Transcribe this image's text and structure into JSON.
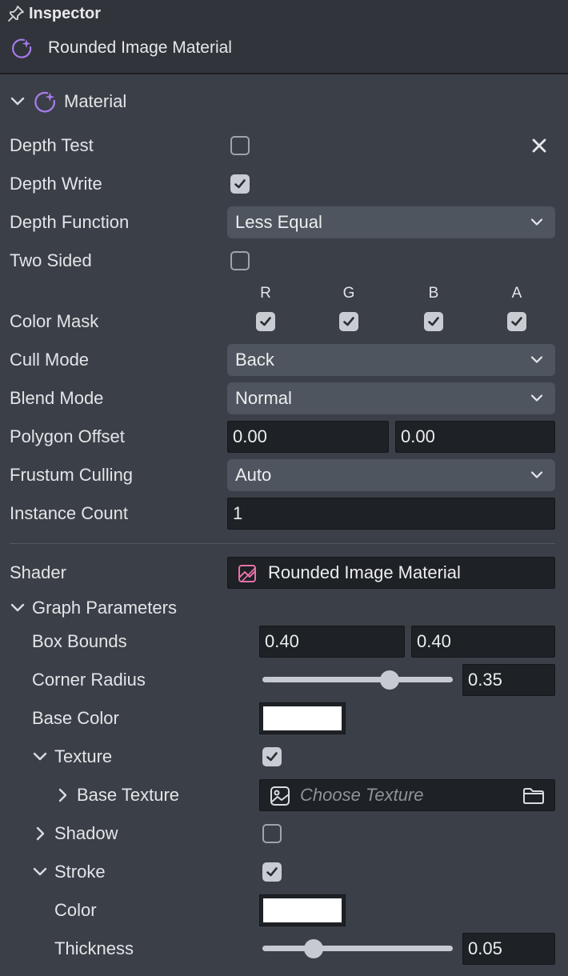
{
  "header": {
    "panel_title": "Inspector",
    "asset_name": "Rounded Image Material"
  },
  "material": {
    "section_label": "Material",
    "depth_test": {
      "label": "Depth Test",
      "checked": false
    },
    "depth_write": {
      "label": "Depth Write",
      "checked": true
    },
    "depth_function": {
      "label": "Depth Function",
      "value": "Less Equal"
    },
    "two_sided": {
      "label": "Two Sided",
      "checked": false
    },
    "color_mask": {
      "label": "Color Mask",
      "channels": [
        "R",
        "G",
        "B",
        "A"
      ],
      "checked": [
        true,
        true,
        true,
        true
      ]
    },
    "cull_mode": {
      "label": "Cull Mode",
      "value": "Back"
    },
    "blend_mode": {
      "label": "Blend Mode",
      "value": "Normal"
    },
    "polygon_offset": {
      "label": "Polygon Offset",
      "value1": "0.00",
      "value2": "0.00"
    },
    "frustum_culling": {
      "label": "Frustum Culling",
      "value": "Auto"
    },
    "instance_count": {
      "label": "Instance Count",
      "value": "1"
    }
  },
  "shader": {
    "label": "Shader",
    "value": "Rounded Image Material"
  },
  "graph_parameters": {
    "label": "Graph Parameters",
    "box_bounds": {
      "label": "Box Bounds",
      "value1": "0.40",
      "value2": "0.40"
    },
    "corner_radius": {
      "label": "Corner Radius",
      "value": "0.35",
      "fraction": 0.67
    },
    "base_color": {
      "label": "Base Color",
      "color": "#ffffff"
    },
    "texture": {
      "label": "Texture",
      "checked": true
    },
    "base_texture": {
      "label": "Base Texture",
      "placeholder": "Choose Texture"
    },
    "shadow": {
      "label": "Shadow",
      "checked": false
    },
    "stroke": {
      "label": "Stroke",
      "checked": true
    },
    "stroke_color": {
      "label": "Color",
      "color": "#ffffff"
    },
    "thickness": {
      "label": "Thickness",
      "value": "0.05",
      "fraction": 0.27
    }
  },
  "colors": {
    "panel_bg": "#3b3f47",
    "header_bg": "#31343a",
    "accent_purple": "#a57be8",
    "accent_pink": "#e472a8"
  }
}
